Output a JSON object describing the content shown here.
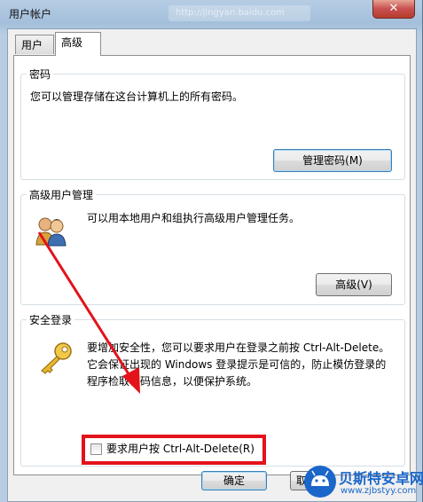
{
  "window": {
    "title": "用户帐户",
    "blurred_address": "http://jingyan.baidu.com",
    "close_glyph": "✕"
  },
  "tabs": [
    {
      "label": "用户",
      "selected": false
    },
    {
      "label": "高级",
      "selected": true
    }
  ],
  "passwords": {
    "title": "密码",
    "description": "您可以管理存储在这台计算机上的所有密码。",
    "button": "管理密码(M)"
  },
  "advanced_user_mgmt": {
    "title": "高级用户管理",
    "description": "可以用本地用户和组执行高级用户管理任务。",
    "button": "高级(V)",
    "icon": "users-icon"
  },
  "secure_logon": {
    "title": "安全登录",
    "line1": "要增加安全性，您可以要求用户在登录之前按 Ctrl-Alt-Delete。",
    "line2": "它会保证出现的 Windows 登录提示是可信的，防止模仿登录的",
    "line3": "程序检取密码信息，以便保护系统。",
    "icon": "key-icon",
    "checkbox_label": "要求用户按 Ctrl-Alt-Delete(R)",
    "checkbox_checked": false
  },
  "footer": {
    "ok": "确定",
    "cancel": "取"
  },
  "watermark": {
    "title": "贝斯特安卓网",
    "url": "www.zjbstyy.com"
  },
  "colors": {
    "annotation_red": "#e3121b",
    "title_blue": "#a4bfdb"
  }
}
